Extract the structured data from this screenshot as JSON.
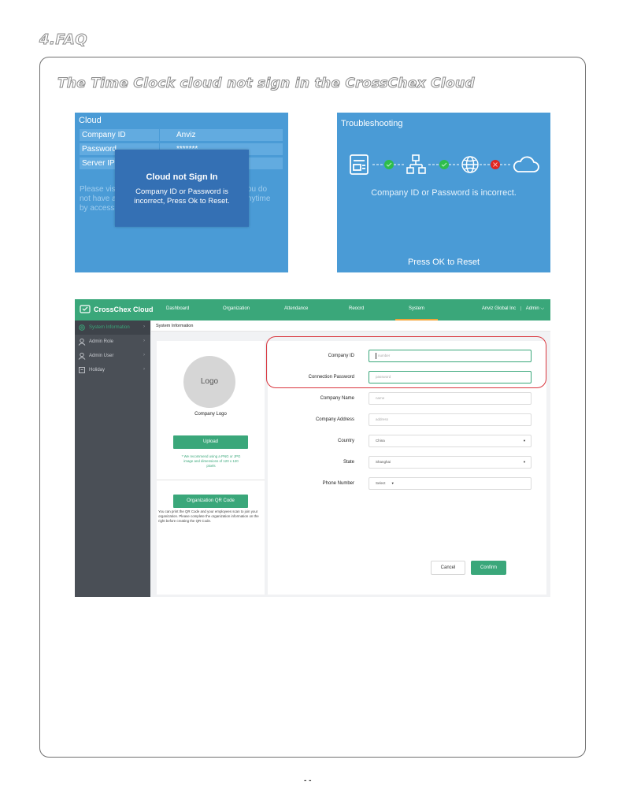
{
  "page": {
    "section_title": "4.FAQ",
    "question": "The Time Clock cloud not sign in the CrossChex Cloud",
    "page_number": "-  -"
  },
  "device_screen_1": {
    "title": "Cloud",
    "rows": [
      {
        "label": "Company ID",
        "value": "Anviz"
      },
      {
        "label": "Password",
        "value": "*******"
      },
      {
        "label": "Server IP",
        "value": ""
      }
    ],
    "hint_left": [
      "Please vis",
      "not have a",
      "by access"
    ],
    "hint_right": [
      "ou do",
      "nytime",
      ""
    ],
    "popup_title": "Cloud not Sign In",
    "popup_message_lines": [
      "Company ID or Password is",
      "incorrect, Press Ok to Reset."
    ],
    "colors": {
      "background": "#4a9bd6",
      "popup": "#3470b4"
    }
  },
  "device_screen_2": {
    "title": "Troubleshooting",
    "chain_icons": [
      "device-icon",
      "network-icon",
      "globe-icon",
      "cloud-icon"
    ],
    "chain_status": [
      "ok",
      "ok",
      "error"
    ],
    "message": "Company ID or Password is incorrect.",
    "footer": "Press OK to Reset",
    "colors": {
      "ok": "#2ebd4c",
      "error": "#e0261f"
    }
  },
  "web_app": {
    "brand": "CrossChex Cloud",
    "nav": [
      "Dashboard",
      "Organization",
      "Attendance",
      "Reocrd",
      "System"
    ],
    "active_nav": "System",
    "account": {
      "company": "Anviz Global Inc",
      "separator": "|",
      "user": "Admin",
      "chevron": "⌵"
    },
    "sidebar": [
      {
        "label": "System Information",
        "icon": "gear-icon",
        "active": true
      },
      {
        "label": "Admin Role",
        "icon": "user-role-icon",
        "active": false
      },
      {
        "label": "Admin User",
        "icon": "user-icon",
        "active": false
      },
      {
        "label": "Holiday",
        "icon": "calendar-icon",
        "active": false
      }
    ],
    "breadcrumb": "System Information",
    "logo_text": "Logo",
    "logo_caption": "Company  Logo",
    "upload_label": "Upload",
    "upload_note": [
      "* We recommend using a PNG or JPG",
      "image and dimensions of 120 x 120",
      "pixels"
    ],
    "qr_button_label": "Organization QR Code",
    "qr_note": "You can print the QR Code and your employees scan to join your organization. Please complete the organization information on the right before creating the QR Code.",
    "fields": [
      {
        "label": "Company ID",
        "placeholder": "number"
      },
      {
        "label": "Connection Password",
        "placeholder": "password"
      },
      {
        "label": "Company  Name",
        "placeholder": "name"
      },
      {
        "label": "Company  Address",
        "placeholder": "address"
      },
      {
        "label": "Country",
        "value": "China"
      },
      {
        "label": "State",
        "value": "Shanghai"
      },
      {
        "label": "Phone Number",
        "value": "Select"
      }
    ],
    "cancel_label": "Cancel",
    "confirm_label": "Confirm",
    "colors": {
      "brand_green": "#3aa77a",
      "sidebar": "#4a4f56",
      "nav_accent": "#f3a53a",
      "highlight": "#d9363e"
    }
  }
}
